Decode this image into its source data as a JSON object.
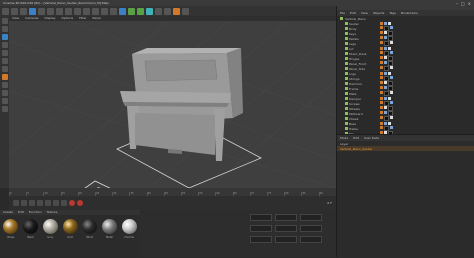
{
  "window": {
    "title": "Cinema 4D R20.026 (RC) - [Vertical_Piano_Sauter_Ruhmmann_M]-Main",
    "controls": [
      "–",
      "□",
      "×"
    ]
  },
  "viewport": {
    "menu": [
      "View",
      "Cameras",
      "Display",
      "Options",
      "Filter",
      "Panel"
    ]
  },
  "object_manager": {
    "menu": [
      "File",
      "Edit",
      "View",
      "Objects",
      "Tags",
      "Bookmarks"
    ],
    "root": "Vertical_Piano",
    "items": [
      "Sauter",
      "Body",
      "Keys",
      "Pedals",
      "Legs",
      "Lid",
      "Music_Desk",
      "Hinges",
      "Panel_Front",
      "Panel_Side",
      "Logo",
      "Strings",
      "Hammer",
      "Frame",
      "Plate",
      "Damper",
      "Screws",
      "Wheels",
      "Fallboard",
      "Cheek",
      "Bass",
      "Treble",
      "Top",
      "Bottom"
    ]
  },
  "attributes": {
    "menu": [
      "Mode",
      "Edit",
      "User Data"
    ],
    "rows": [
      "Layer",
      "Vertical_Piano_Sauter"
    ]
  },
  "timeline": {
    "ticks": [
      "0",
      "5",
      "10",
      "15",
      "20",
      "25",
      "30",
      "35",
      "40",
      "45",
      "50",
      "55",
      "60",
      "65",
      "70",
      "75",
      "80",
      "85",
      "90"
    ],
    "frame": "0 F"
  },
  "materials": {
    "menu": [
      "Create",
      "Edit",
      "Function",
      "Texture"
    ],
    "items": [
      {
        "name": "Brass",
        "color": "#a87a2a"
      },
      {
        "name": "Black",
        "color": "#1a1a1a"
      },
      {
        "name": "Ivory",
        "color": "#b7b1a6"
      },
      {
        "name": "Gold",
        "color": "#8f6a20"
      },
      {
        "name": "Wood",
        "color": "#2b2b2b"
      },
      {
        "name": "Metal",
        "color": "#7b7b7b"
      },
      {
        "name": "Chrome",
        "color": "#cfcfcf"
      }
    ]
  }
}
